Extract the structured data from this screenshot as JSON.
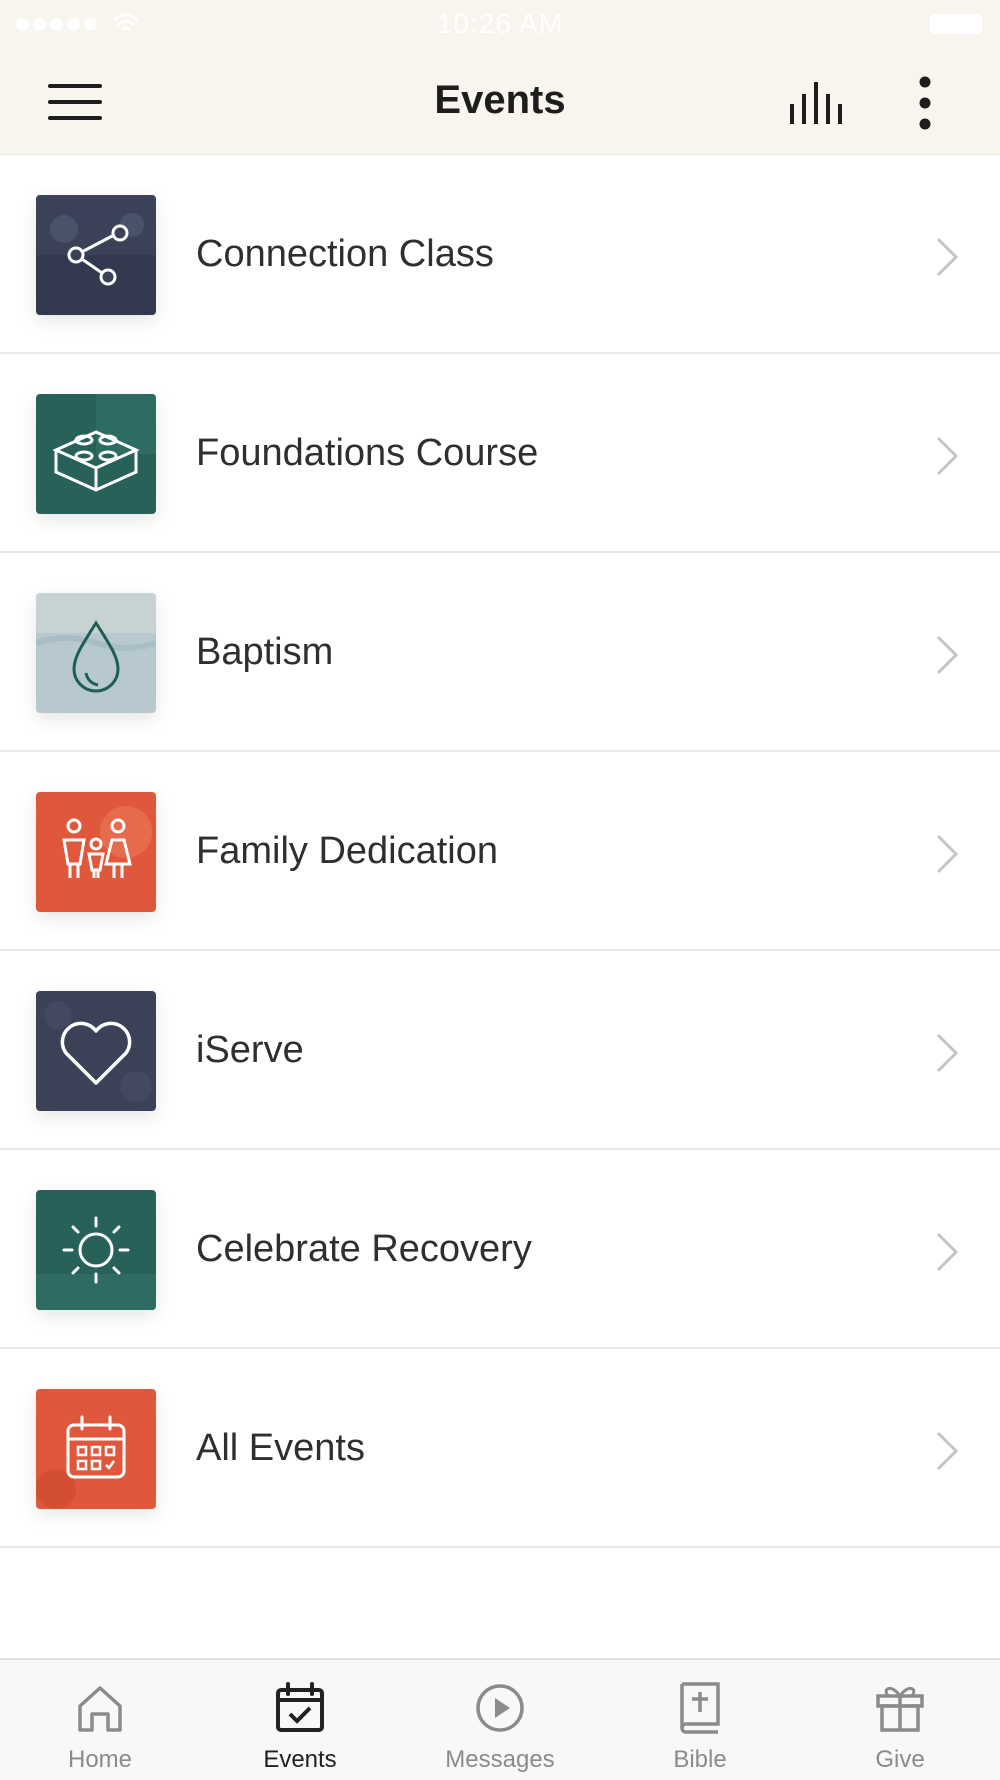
{
  "status_bar": {
    "time": "10:26 AM"
  },
  "header": {
    "title": "Events"
  },
  "events": [
    {
      "title": "Connection Class",
      "icon": "share-icon"
    },
    {
      "title": "Foundations Course",
      "icon": "lego-brick-icon"
    },
    {
      "title": "Baptism",
      "icon": "water-drop-icon"
    },
    {
      "title": "Family Dedication",
      "icon": "family-icon"
    },
    {
      "title": "iServe",
      "icon": "heart-icon"
    },
    {
      "title": "Celebrate Recovery",
      "icon": "sun-icon"
    },
    {
      "title": "All Events",
      "icon": "calendar-icon"
    }
  ],
  "tabs": [
    {
      "label": "Home",
      "icon": "home-icon"
    },
    {
      "label": "Events",
      "icon": "calendar-check-icon",
      "active": true
    },
    {
      "label": "Messages",
      "icon": "play-circle-icon"
    },
    {
      "label": "Bible",
      "icon": "bible-icon"
    },
    {
      "label": "Give",
      "icon": "gift-icon"
    }
  ],
  "colors": {
    "header_bg": "#f8f5ee",
    "slate_tile": "#3b4258",
    "teal_tile": "#27615a",
    "mist_tile": "#b7c9ce",
    "coral_tile": "#e0583c",
    "active_tab": "#222222",
    "inactive_tab": "#8b8b8b"
  }
}
